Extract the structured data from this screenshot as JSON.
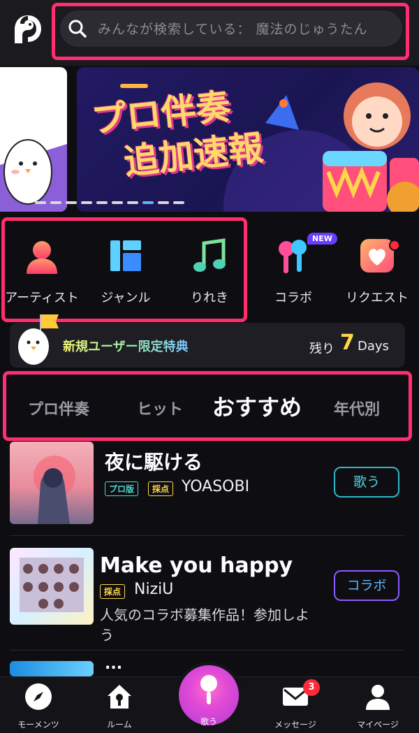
{
  "search": {
    "placeholder": "みんなが検索している： 魔法のじゅうたん"
  },
  "banner": {
    "title_line1": "プロ伴奏",
    "title_line2": "追加速報"
  },
  "categories": [
    {
      "label": "アーティスト",
      "icon": "artist-icon"
    },
    {
      "label": "ジャンル",
      "icon": "genre-icon"
    },
    {
      "label": "りれき",
      "icon": "history-icon"
    },
    {
      "label": "コラボ",
      "icon": "collab-mic-icon",
      "badge": "NEW"
    },
    {
      "label": "リクエスト",
      "icon": "request-heart-icon"
    }
  ],
  "promo": {
    "text": "新規ユーザー限定特典",
    "remain_label": "残り",
    "days_number": "7",
    "days_unit": "Days"
  },
  "tabs": [
    {
      "label": "プロ伴奏",
      "active": false
    },
    {
      "label": "ヒット",
      "active": false
    },
    {
      "label": "おすすめ",
      "active": true
    },
    {
      "label": "年代別",
      "active": false
    }
  ],
  "songs": [
    {
      "title": "夜に駆ける",
      "tags": [
        "プロ版",
        "採点"
      ],
      "artist": "YOASOBI",
      "button": "歌う"
    },
    {
      "title": "Make you happy",
      "tags": [
        "採点"
      ],
      "artist": "NiziU",
      "button": "コラボ",
      "description": "人気のコラボ募集作品！参加しよう"
    },
    {
      "title": "..."
    }
  ],
  "nav": {
    "items": [
      {
        "label": "モーメンツ",
        "icon": "compass-icon"
      },
      {
        "label": "ルーム",
        "icon": "room-house-icon"
      },
      {
        "label": "歌う",
        "icon": "microphone-icon"
      },
      {
        "label": "メッセージ",
        "icon": "mail-icon",
        "badge": "3"
      },
      {
        "label": "マイページ",
        "icon": "person-icon"
      }
    ]
  },
  "colors": {
    "highlight": "#ff2e6e",
    "accent_blue": "#5ab8ff",
    "days_yellow": "#ffd84a"
  }
}
